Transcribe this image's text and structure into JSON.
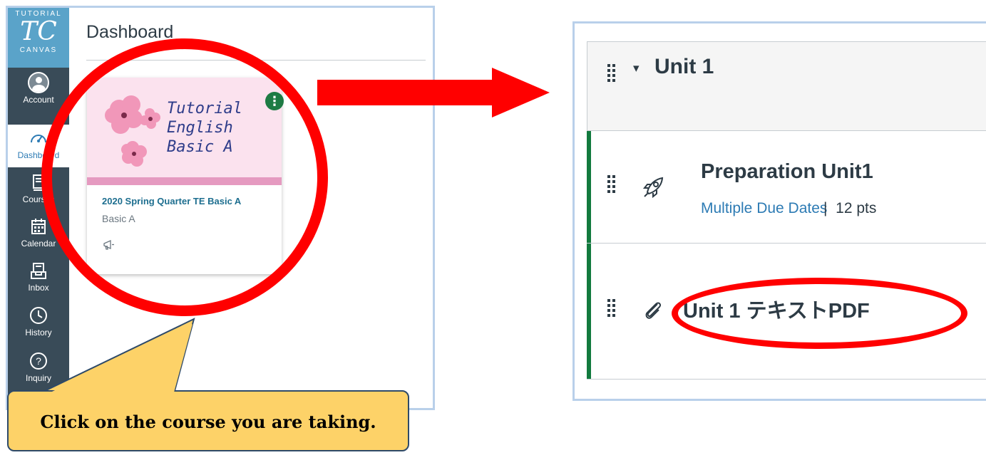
{
  "logo": {
    "top": "TUTORIAL",
    "mark": "TC",
    "bottom": "CANVAS"
  },
  "nav": {
    "items": [
      {
        "label": "Account",
        "icon": "account-avatar-icon"
      },
      {
        "label": "Dashboard",
        "icon": "dashboard-gauge-icon",
        "active": true
      },
      {
        "label": "Courses",
        "icon": "courses-book-icon"
      },
      {
        "label": "Calendar",
        "icon": "calendar-icon"
      },
      {
        "label": "Inbox",
        "icon": "inbox-icon"
      },
      {
        "label": "History",
        "icon": "clock-icon"
      },
      {
        "label": "Inquiry",
        "icon": "question-circle-icon"
      }
    ]
  },
  "dashboard": {
    "title": "Dashboard",
    "course_card": {
      "hero_lines": [
        "Tutorial",
        "English",
        "Basic A"
      ],
      "name": "2020 Spring Quarter TE Basic A",
      "subtitle": "Basic A",
      "colors": {
        "hero": "#fbe2ee",
        "stripe": "#e59ac0",
        "kebab": "#1e7b44"
      }
    }
  },
  "callout": {
    "text": "Click on the course you are taking."
  },
  "module": {
    "header": "Unit 1",
    "items": [
      {
        "title": "Preparation Unit1",
        "icon": "rocket-icon",
        "due": "Multiple Due Dates",
        "separator": "|",
        "points": "12 pts"
      },
      {
        "title": "Unit 1 テキストPDF",
        "icon": "paperclip-icon"
      }
    ]
  },
  "colors": {
    "annotation_red": "#ff0000",
    "nav_bg": "#394b58",
    "link": "#2d7bb4",
    "module_bar": "#127a3e"
  }
}
